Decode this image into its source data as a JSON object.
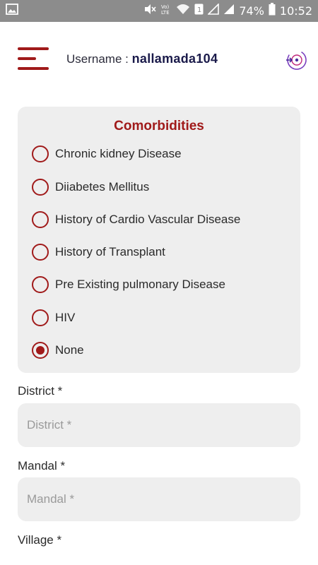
{
  "status_bar": {
    "battery": "74%",
    "time": "10:52",
    "icons": [
      "image-icon",
      "mute-icon",
      "volte-icon",
      "wifi-icon",
      "sim-icon",
      "signal-icon",
      "signal-icon",
      "battery-icon"
    ]
  },
  "header": {
    "username_label": "Username : ",
    "username": "nallamada104"
  },
  "comorbidities": {
    "title": "Comorbidities",
    "options": [
      {
        "label": "Chronic kidney Disease",
        "selected": false
      },
      {
        "label": "Diiabetes Mellitus",
        "selected": false
      },
      {
        "label": "History of Cardio Vascular Disease",
        "selected": false
      },
      {
        "label": "History of Transplant",
        "selected": false
      },
      {
        "label": "Pre Existing pulmonary Disease",
        "selected": false
      },
      {
        "label": "HIV",
        "selected": false
      },
      {
        "label": "None",
        "selected": true
      }
    ]
  },
  "form": {
    "district": {
      "label": "District *",
      "placeholder": "District *",
      "value": ""
    },
    "mandal": {
      "label": "Mandal *",
      "placeholder": "Mandal *",
      "value": ""
    },
    "village": {
      "label": "Village *"
    }
  },
  "colors": {
    "accent": "#a01a1a",
    "card_bg": "#eeeeee",
    "status_bar_bg": "#8c8c8c"
  }
}
